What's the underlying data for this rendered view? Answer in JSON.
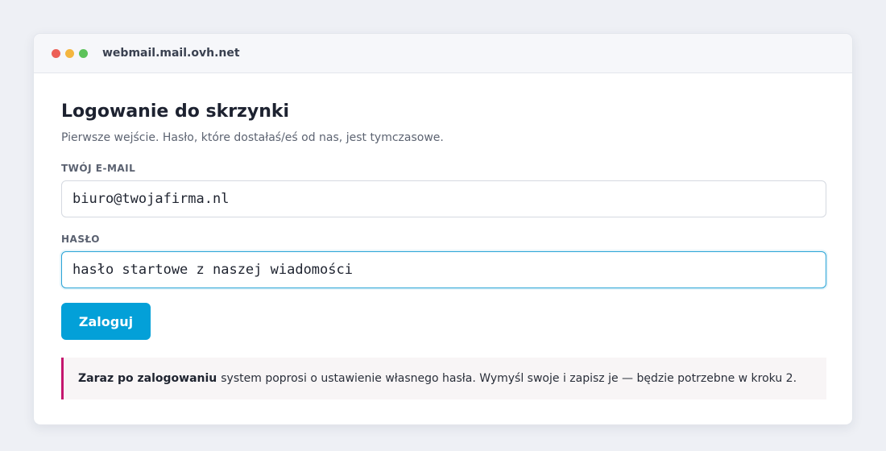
{
  "window": {
    "url": "webmail.mail.ovh.net"
  },
  "form": {
    "title": "Logowanie do skrzynki",
    "subtitle": "Pierwsze wejście. Hasło, które dostałaś/eś od nas, jest tymczasowe.",
    "email_label": "TWÓJ E-MAIL",
    "email_value": "biuro@twojafirma.nl",
    "password_label": "HASŁO",
    "password_value": "hasło startowe z naszej wiadomości",
    "login_label": "Zaloguj"
  },
  "notice": {
    "bold_text": "Zaraz po zalogowaniu",
    "text": "system poprosi o ustawienie własnego hasła. Wymyśl swoje i zapisz je — będzie potrzebne w kroku 2."
  },
  "colors": {
    "accent": "#03a0d8",
    "notice_border": "#c4166e",
    "focus_border": "#2aa4d6"
  }
}
